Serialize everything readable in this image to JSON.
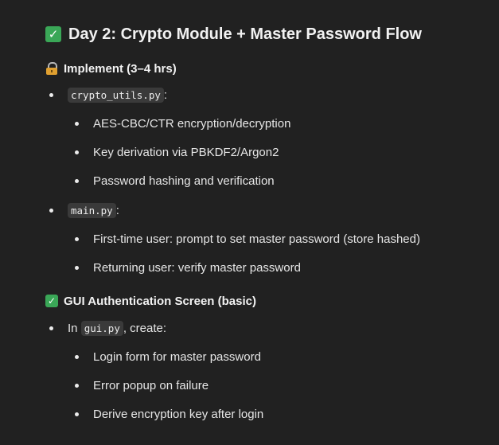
{
  "heading": {
    "title": "Day 2: Crypto Module + Master Password Flow",
    "icon": "check-mark-button-icon"
  },
  "implement": {
    "title": "Implement (3–4 hrs)",
    "icon": "lock-icon",
    "items": [
      {
        "code": "crypto_utils.py",
        "suffix": ":",
        "subitems": [
          "AES-CBC/CTR encryption/decryption",
          "Key derivation via PBKDF2/Argon2",
          "Password hashing and verification"
        ]
      },
      {
        "code": "main.py",
        "suffix": ":",
        "subitems": [
          "First-time user: prompt to set master password (store hashed)",
          "Returning user: verify master password"
        ]
      }
    ]
  },
  "gui": {
    "title": "GUI Authentication Screen (basic)",
    "icon": "check-mark-button-icon",
    "items": [
      {
        "prefix": "In ",
        "code": "gui.py",
        "suffix": ", create:",
        "subitems": [
          "Login form for master password",
          "Error popup on failure",
          "Derive encryption key after login"
        ]
      }
    ]
  },
  "colors": {
    "background": "#212121",
    "text": "#ececec",
    "code_background": "#3a3a3a",
    "check_green": "#3aa757"
  }
}
